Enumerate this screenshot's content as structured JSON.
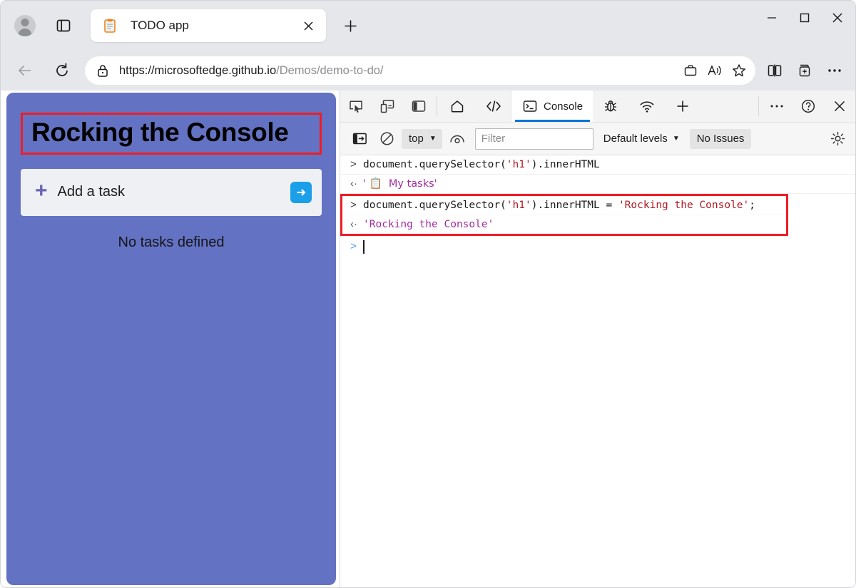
{
  "browser": {
    "profile_icon": "avatar-icon",
    "tab_list_icon": "tab-list-icon",
    "tab": {
      "favicon": "clipboard-icon",
      "title": "TODO app",
      "close_icon": "close-icon"
    },
    "new_tab_icon": "plus-icon",
    "window_controls": {
      "minimize": "minimize-icon",
      "maximize": "maximize-icon",
      "close": "close-icon"
    },
    "nav": {
      "back_icon": "back-arrow-icon",
      "refresh_icon": "refresh-icon",
      "lock_icon": "lock-icon",
      "url_domain": "https://microsoftedge.github.io",
      "url_path": "/Demos/demo-to-do/",
      "collections_icon": "collections-icon",
      "read_aloud_icon": "read-aloud-icon",
      "favorite_icon": "star-icon",
      "split_screen_icon": "split-screen-icon",
      "add_collection_icon": "add-to-collections-icon",
      "settings_more_icon": "ellipsis-icon"
    }
  },
  "page": {
    "heading": "Rocking the Console",
    "add_task": {
      "plus": "+",
      "label": "Add a task",
      "submit_icon": "arrow-right-icon"
    },
    "empty_state": "No tasks defined",
    "colors": {
      "card_background": "#6472c3",
      "input_background": "#eff0f4",
      "submit_button": "#1b9fe8",
      "highlight_border": "#ee1d26"
    }
  },
  "devtools": {
    "left_icons": [
      {
        "name": "inspect-element-icon"
      },
      {
        "name": "device-emulation-icon"
      },
      {
        "name": "dock-side-icon"
      }
    ],
    "tabs": [
      {
        "name": "welcome-home-tab",
        "icon": "home-icon",
        "label": "",
        "active": false
      },
      {
        "name": "elements-tab",
        "icon": "code-brackets-icon",
        "label": "",
        "active": false
      },
      {
        "name": "console-tab",
        "icon": "console-terminal-icon",
        "label": "Console",
        "active": true
      },
      {
        "name": "debugger-tab",
        "icon": "bug-icon",
        "label": "",
        "active": false
      },
      {
        "name": "network-tab",
        "icon": "wifi-icon",
        "label": "",
        "active": false
      },
      {
        "name": "more-tools-tab",
        "icon": "plus-icon",
        "label": "",
        "active": false
      }
    ],
    "right_icons": [
      {
        "name": "more-options-icon"
      },
      {
        "name": "help-icon"
      },
      {
        "name": "close-devtools-icon"
      }
    ],
    "filterbar": {
      "sidebar_toggle_icon": "console-sidebar-icon",
      "clear_console_icon": "clear-console-icon",
      "context_value": "top",
      "live_expression_icon": "live-expression-eye-icon",
      "filter_placeholder": "Filter",
      "log_levels": "Default levels",
      "issues": "No Issues",
      "settings_icon": "gear-icon"
    },
    "console_entries": [
      {
        "type": "input",
        "glyph": ">",
        "highlighted": false,
        "parts": [
          {
            "text": "document.querySelector(",
            "style": "code"
          },
          {
            "text": "'h1'",
            "style": "str"
          },
          {
            "text": ").innerHTML",
            "style": "code"
          }
        ]
      },
      {
        "type": "output",
        "glyph": "‹·",
        "highlighted": false,
        "parts": [
          {
            "text": "' 📋  My tasks'",
            "style": "result"
          }
        ]
      },
      {
        "type": "input",
        "glyph": ">",
        "highlighted": true,
        "parts": [
          {
            "text": "document.querySelector(",
            "style": "code"
          },
          {
            "text": "'h1'",
            "style": "str"
          },
          {
            "text": ").innerHTML = ",
            "style": "code"
          },
          {
            "text": "'Rocking the Console'",
            "style": "str"
          },
          {
            "text": ";",
            "style": "code"
          }
        ]
      },
      {
        "type": "output",
        "glyph": "‹·",
        "highlighted": true,
        "parts": [
          {
            "text": "'Rocking the Console'",
            "style": "result"
          }
        ]
      }
    ],
    "prompt": {
      "glyph": ">",
      "value": ""
    }
  }
}
